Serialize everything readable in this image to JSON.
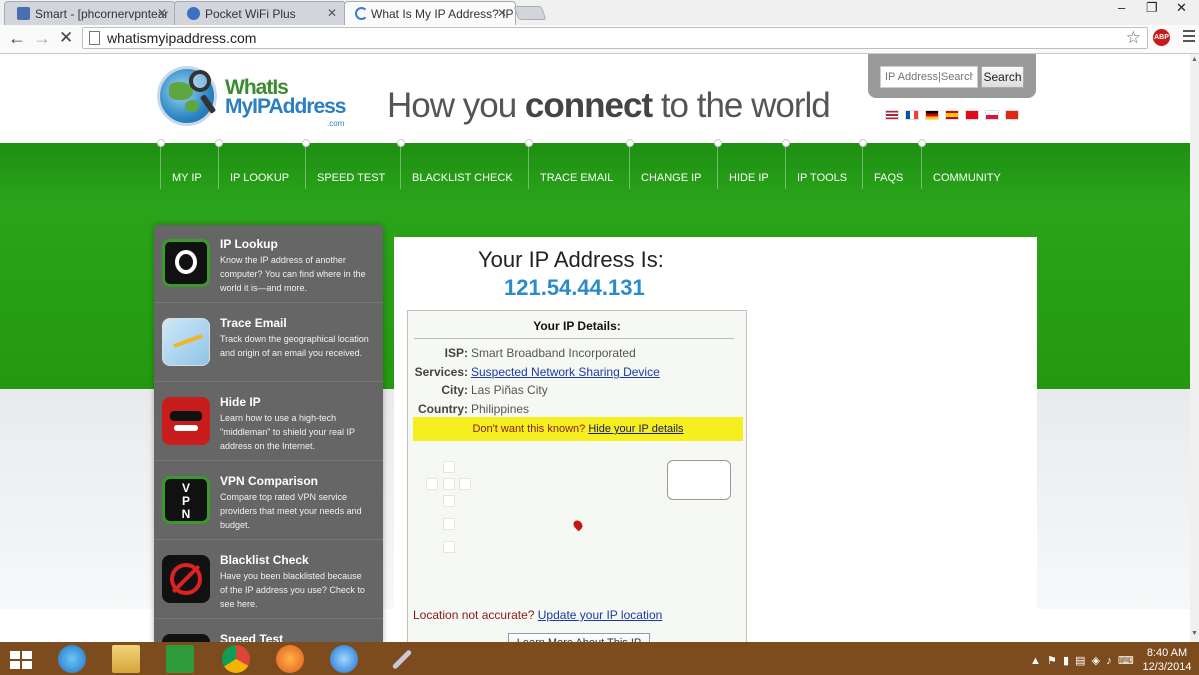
{
  "browser": {
    "tabs": [
      {
        "title": "Smart - [phcornervpntear",
        "active": false
      },
      {
        "title": "Pocket WiFi Plus",
        "active": false
      },
      {
        "title": "What Is My IP Address? IP",
        "active": true
      }
    ],
    "url": "whatismyipaddress.com"
  },
  "site": {
    "logo": {
      "line1": "WhatIs",
      "line2": "MyIPAddress",
      "suffix": ".com"
    },
    "tagline": {
      "pre": "How you ",
      "bold": "connect",
      "post": " to the world"
    },
    "search": {
      "placeholder": "IP Address|Search",
      "button": "Search"
    },
    "nav": [
      "MY IP",
      "IP LOOKUP",
      "SPEED TEST",
      "BLACKLIST CHECK",
      "TRACE EMAIL",
      "CHANGE IP",
      "HIDE IP",
      "IP TOOLS",
      "FAQS",
      "COMMUNITY"
    ],
    "sidebar": [
      {
        "title": "IP Lookup",
        "desc": "Know the IP address of another computer? You can find where in the world it is—and more.",
        "icon": "ip-lookup-icon"
      },
      {
        "title": "Trace Email",
        "desc": "Track down the geographical location and origin of an email you received.",
        "icon": "map-icon"
      },
      {
        "title": "Hide IP",
        "desc": "Learn how to use a high-tech \"middleman\" to shield your real IP address on the Internet.",
        "icon": "mask-icon"
      },
      {
        "title": "VPN Comparison",
        "desc": "Compare top rated VPN service providers that meet your needs and budget.",
        "icon": "vpn-icon"
      },
      {
        "title": "Blacklist Check",
        "desc": "Have you been blacklisted because of the IP address you use? Check to see here.",
        "icon": "blacklist-icon"
      },
      {
        "title": "Speed Test",
        "desc": "",
        "icon": "speedometer-icon"
      }
    ],
    "main": {
      "heading": "Your IP Address Is:",
      "ip": "121.54.44.131",
      "details_title": "Your IP Details:",
      "isp_label": "ISP:",
      "isp": "Smart Broadband Incorporated",
      "services_label": "Services:",
      "services": "Suspected Network Sharing Device",
      "city_label": "City:",
      "city": "Las Piñas City",
      "country_label": "Country:",
      "country": "Philippines",
      "warn_text": "Don't want this known?",
      "warn_link": "Hide your IP details",
      "loc_text": "Location not accurate?",
      "loc_link": "Update your IP location",
      "learn_more": "Learn More About This IP"
    }
  },
  "taskbar": {
    "time": "8:40 AM",
    "date": "12/3/2014"
  }
}
